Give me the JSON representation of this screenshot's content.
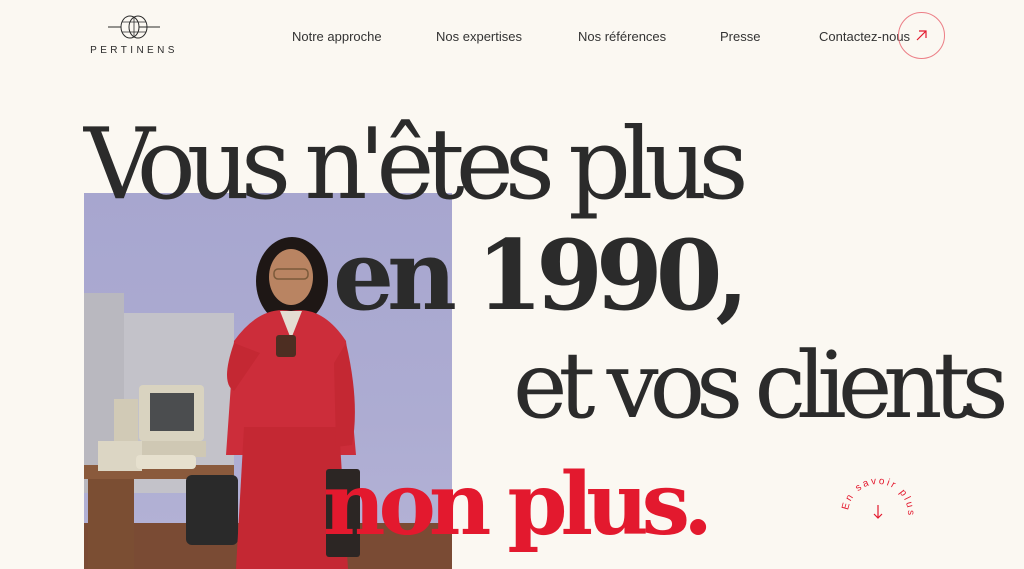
{
  "brand": {
    "name": "PERTINENS"
  },
  "nav": {
    "items": [
      "Notre approche",
      "Nos expertises",
      "Nos références",
      "Presse",
      "Contactez-nous"
    ]
  },
  "hero": {
    "line1": "Vous n'êtes plus",
    "line2": "en 1990,",
    "line3": "et vos clients",
    "line4": "non plus."
  },
  "cta": {
    "label": "En savoir plus"
  },
  "colors": {
    "background": "#fbf8f2",
    "accent": "#e3192e",
    "text": "#2b2b2b"
  }
}
